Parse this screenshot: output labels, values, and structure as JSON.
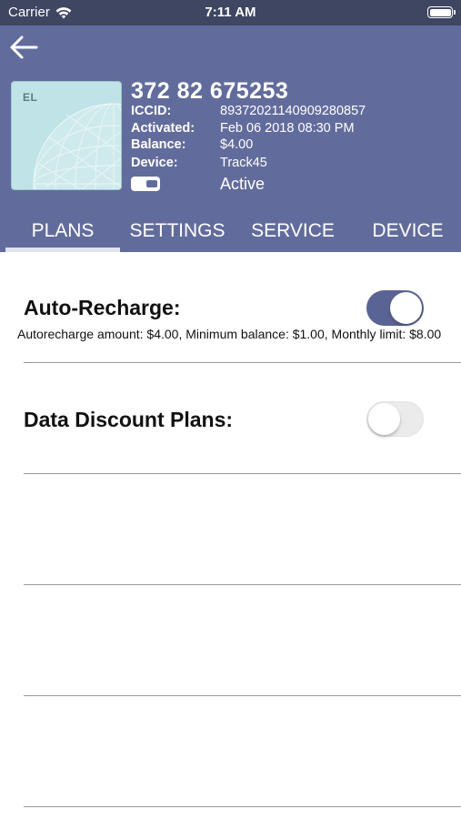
{
  "status_bar": {
    "carrier": "Carrier",
    "time": "7:11 AM"
  },
  "sim": {
    "card_tag": "EL",
    "number": "372 82 675253",
    "fields": [
      {
        "key": "ICCID:",
        "value": "89372021140909280857"
      },
      {
        "key": "Activated:",
        "value": "Feb 06 2018 08:30 PM"
      },
      {
        "key": "Balance:",
        "value": "$4.00"
      },
      {
        "key": "Device:",
        "value": "Track45"
      }
    ],
    "status": "Active",
    "status_toggle_on": true
  },
  "tabs": [
    {
      "label": "PLANS",
      "active": true
    },
    {
      "label": "SETTINGS",
      "active": false
    },
    {
      "label": "SERVICE",
      "active": false
    },
    {
      "label": "DEVICE",
      "active": false
    }
  ],
  "settings": {
    "auto_recharge": {
      "title": "Auto-Recharge:",
      "details": "Autorecharge amount: $4.00, Minimum balance: $1.00, Monthly limit: $8.00",
      "enabled": true
    },
    "data_discount": {
      "title": "Data Discount Plans:",
      "enabled": false
    }
  },
  "colors": {
    "header": "#626c9c",
    "status_bar": "#3e4661",
    "switch_on": "#5a6494",
    "switch_off": "#ebebeb"
  }
}
